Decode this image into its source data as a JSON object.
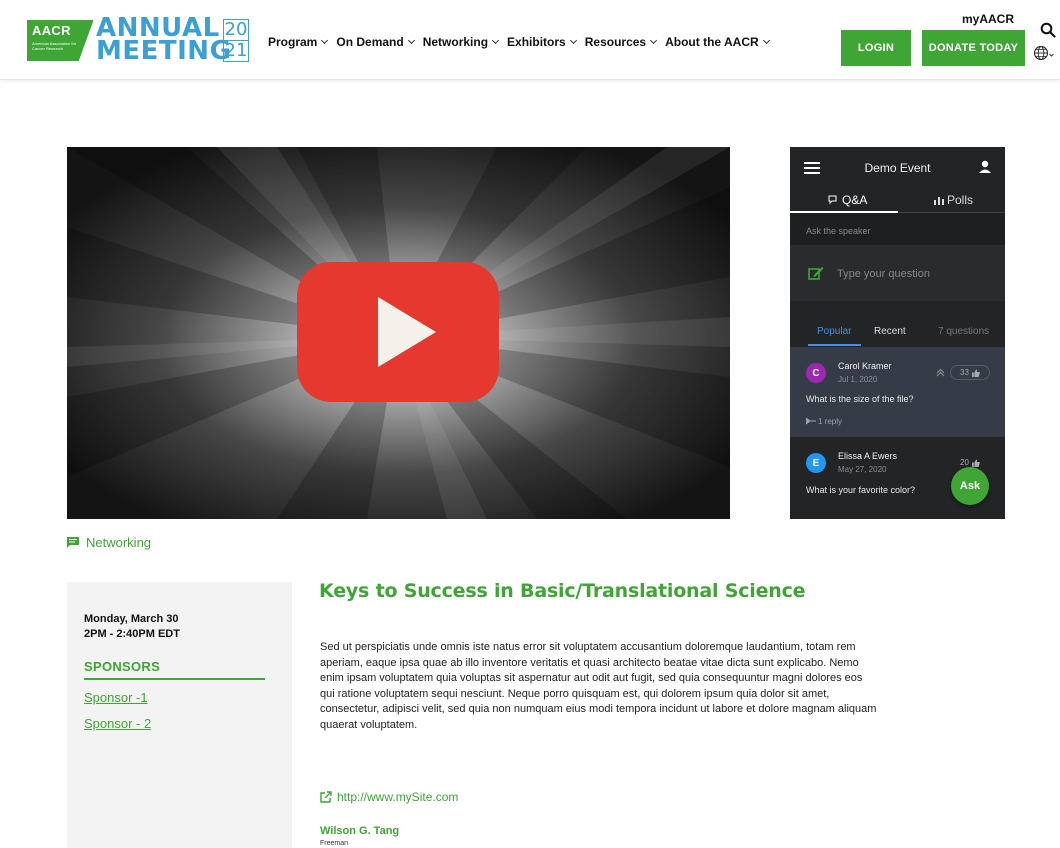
{
  "header": {
    "logo": {
      "org": "AACR",
      "org_sub": "American Association for Cancer Research",
      "line1": "ANNUAL",
      "line2": "MEETING",
      "year_top": "20",
      "year_bottom": "21"
    },
    "nav": [
      "Program",
      "On Demand",
      "Networking",
      "Exhibitors",
      "Resources",
      "About the AACR"
    ],
    "my_account": "myAACR",
    "login_label": "LOGIN",
    "donate_label": "DONATE TODAY"
  },
  "qa_panel": {
    "event_title": "Demo Event",
    "tabs": [
      "Q&A",
      "Polls"
    ],
    "ask_label": "Ask the speaker",
    "input_placeholder": "Type your question",
    "sort": {
      "popular": "Popular",
      "recent": "Recent",
      "count": "7 questions"
    },
    "questions": [
      {
        "initial": "C",
        "name": "Carol Kramer",
        "date": "Jul 1, 2020",
        "text": "What is the size of the file?",
        "votes": "33",
        "replies": "1 reply"
      },
      {
        "initial": "E",
        "name": "Elissa A Ewers",
        "date": "May 27, 2020",
        "text": "What is your favorite color?",
        "votes": "20"
      }
    ],
    "ask_button": "Ask"
  },
  "session": {
    "category": "Networking",
    "date": "Monday, March 30",
    "time": "2PM - 2:40PM EDT",
    "sponsors_heading": "SPONSORS",
    "sponsors": [
      "Sponsor -1",
      "Sponsor - 2"
    ],
    "title": "Keys to Success in Basic/Translational Science",
    "description": "Sed ut perspiciatis unde omnis iste natus error sit voluptatem accusantium doloremque laudantium, totam rem aperiam, eaque ipsa quae ab illo inventore veritatis et quasi architecto beatae vitae dicta sunt explicabo. Nemo enim ipsam voluptatem quia voluptas sit aspernatur aut odit aut fugit, sed quia consequuntur magni dolores eos qui ratione voluptatem sequi nesciunt. Neque porro quisquam est, qui dolorem ipsum quia dolor sit amet, consectetur, adipisci velit, sed quia non numquam eius modi tempora incidunt ut labore et dolore magnam aliquam quaerat voluptatem.",
    "website": "http://www.mySite.com",
    "speaker_name": "Wilson G. Tang",
    "speaker_role": "Freeman"
  },
  "colors": {
    "brand_green": "#3fa535",
    "brand_blue": "#3aa0d6",
    "play_red": "#e5392f",
    "qa_accent": "#4a90e2"
  },
  "icons": [
    "search-icon",
    "globe-icon",
    "menu-icon",
    "user-icon",
    "chat-icon",
    "bar-chart-icon",
    "edit-icon",
    "chevron-up-icon",
    "thumbs-up-icon",
    "reply-icon",
    "comment-icon",
    "external-link-icon",
    "play-icon"
  ]
}
